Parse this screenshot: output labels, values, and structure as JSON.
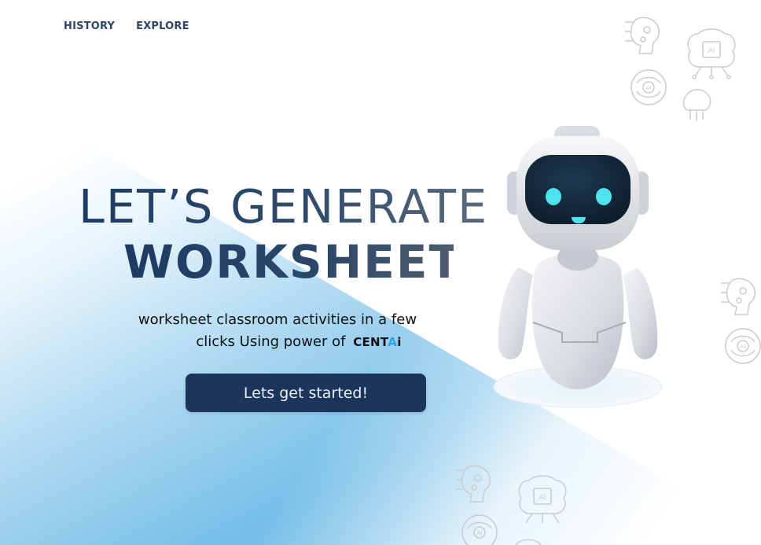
{
  "nav": {
    "items": [
      {
        "label": "HISTORY"
      },
      {
        "label": "EXPLORE"
      }
    ]
  },
  "hero": {
    "title_line1": "LET’S GENERATE",
    "title_line2": "WORKSHEET",
    "subtitle_line1": "worksheet classroom activities in a few",
    "subtitle_line2": "clicks Using power of",
    "brand_main": "CENT",
    "brand_accent": "A",
    "brand_tail": "i",
    "cta_label": "Lets get started!"
  },
  "decor": {
    "ai_chip_label": "AI"
  },
  "colors": {
    "primary": "#1b365a",
    "nav_text": "#2c4666",
    "accent_blue": "#2aa3e0",
    "background_gradient_blue": "#5db1e2",
    "robot_eye": "#4fe3f0"
  }
}
